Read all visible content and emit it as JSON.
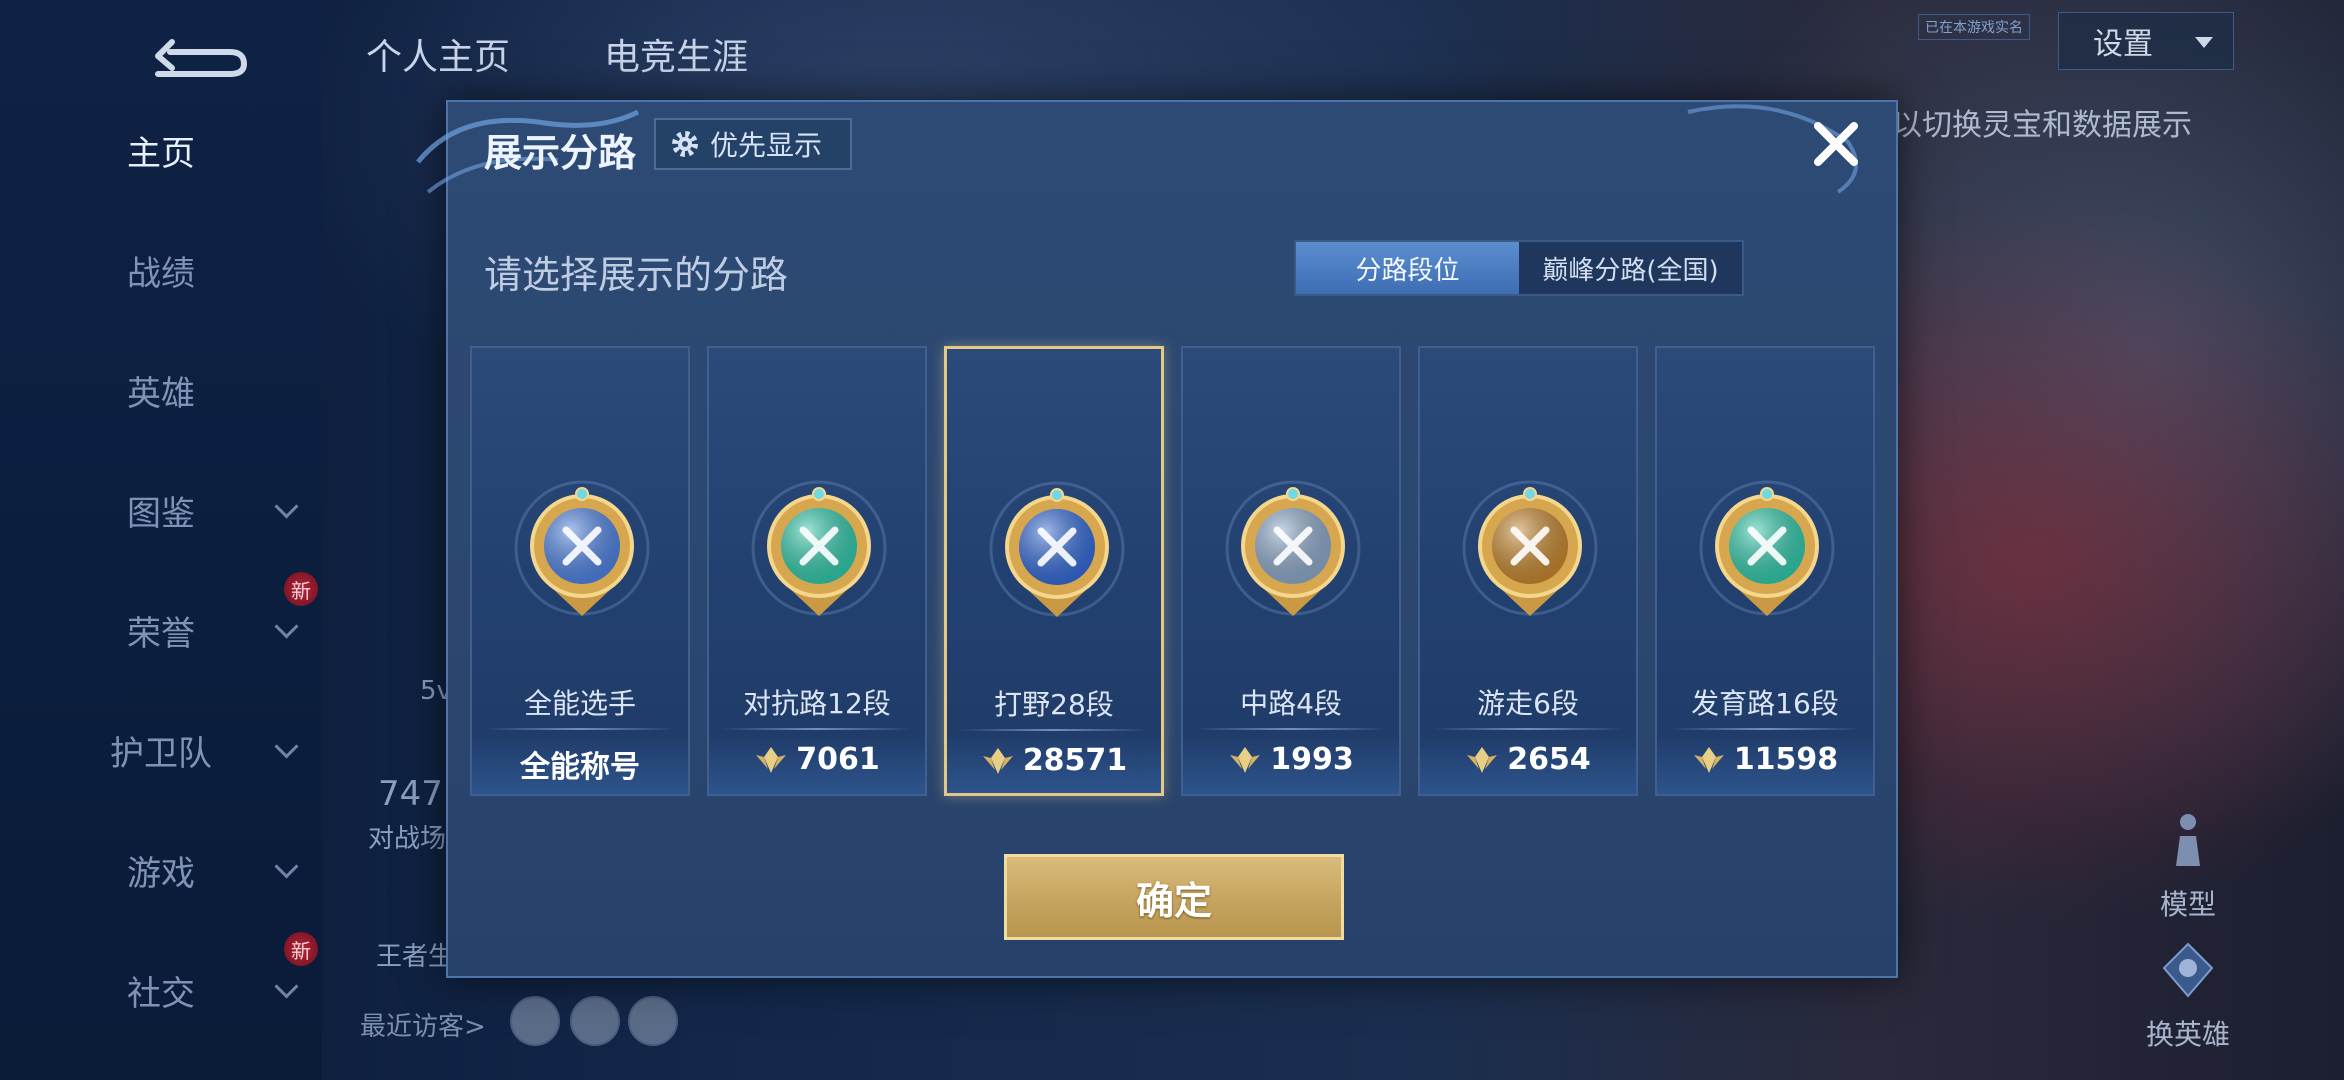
{
  "background": {
    "top_tabs": [
      "个人主页",
      "电竞生涯"
    ],
    "settings_label": "设置",
    "tag_text": "已在本游戏实名",
    "hint_text": "以切换灵宝和数据展示",
    "left_texts": [
      "5v",
      "747",
      "对战场",
      "王者生"
    ],
    "visitor_label": "最近访客>",
    "side_buttons": [
      {
        "label": "模型",
        "icon": "figure-icon"
      },
      {
        "label": "换英雄",
        "icon": "swap-hero-icon"
      }
    ]
  },
  "sidebar": {
    "items": [
      {
        "label": "主页",
        "active": true,
        "chevron": false,
        "new": false
      },
      {
        "label": "战绩",
        "active": false,
        "chevron": false,
        "new": false
      },
      {
        "label": "英雄",
        "active": false,
        "chevron": false,
        "new": false
      },
      {
        "label": "图鉴",
        "active": false,
        "chevron": true,
        "new": false
      },
      {
        "label": "荣誉",
        "active": false,
        "chevron": true,
        "new": true
      },
      {
        "label": "护卫队",
        "active": false,
        "chevron": true,
        "new": false
      },
      {
        "label": "游戏",
        "active": false,
        "chevron": true,
        "new": false
      },
      {
        "label": "社交",
        "active": false,
        "chevron": true,
        "new": true
      }
    ],
    "new_badge": "新"
  },
  "modal": {
    "title": "展示分路",
    "priority_button": "优先显示",
    "subtitle": "请选择展示的分路",
    "segment": {
      "options": [
        "分路段位",
        "巅峰分路(全国)"
      ],
      "selected": 0
    },
    "confirm_label": "确定",
    "lanes": [
      {
        "name": "全能选手",
        "value": "全能称号",
        "has_icon": false,
        "selected": false,
        "color": "#4a7fe0",
        "icon": "all-round-emblem-icon"
      },
      {
        "name": "对抗路12段",
        "value": "7061",
        "has_icon": true,
        "selected": false,
        "color": "#2cc7a8",
        "icon": "clash-lane-emblem-icon"
      },
      {
        "name": "打野28段",
        "value": "28571",
        "has_icon": true,
        "selected": true,
        "color": "#2f66d6",
        "icon": "jungle-emblem-icon"
      },
      {
        "name": "中路4段",
        "value": "1993",
        "has_icon": true,
        "selected": false,
        "color": "#8aa6c8",
        "icon": "mid-lane-emblem-icon"
      },
      {
        "name": "游走6段",
        "value": "2654",
        "has_icon": true,
        "selected": false,
        "color": "#c4842a",
        "icon": "roam-emblem-icon"
      },
      {
        "name": "发育路16段",
        "value": "11598",
        "has_icon": true,
        "selected": false,
        "color": "#2cc7a8",
        "icon": "farm-lane-emblem-icon"
      }
    ]
  },
  "colors": {
    "gold": "#e2c98a",
    "accent_blue": "#3d6db3"
  }
}
